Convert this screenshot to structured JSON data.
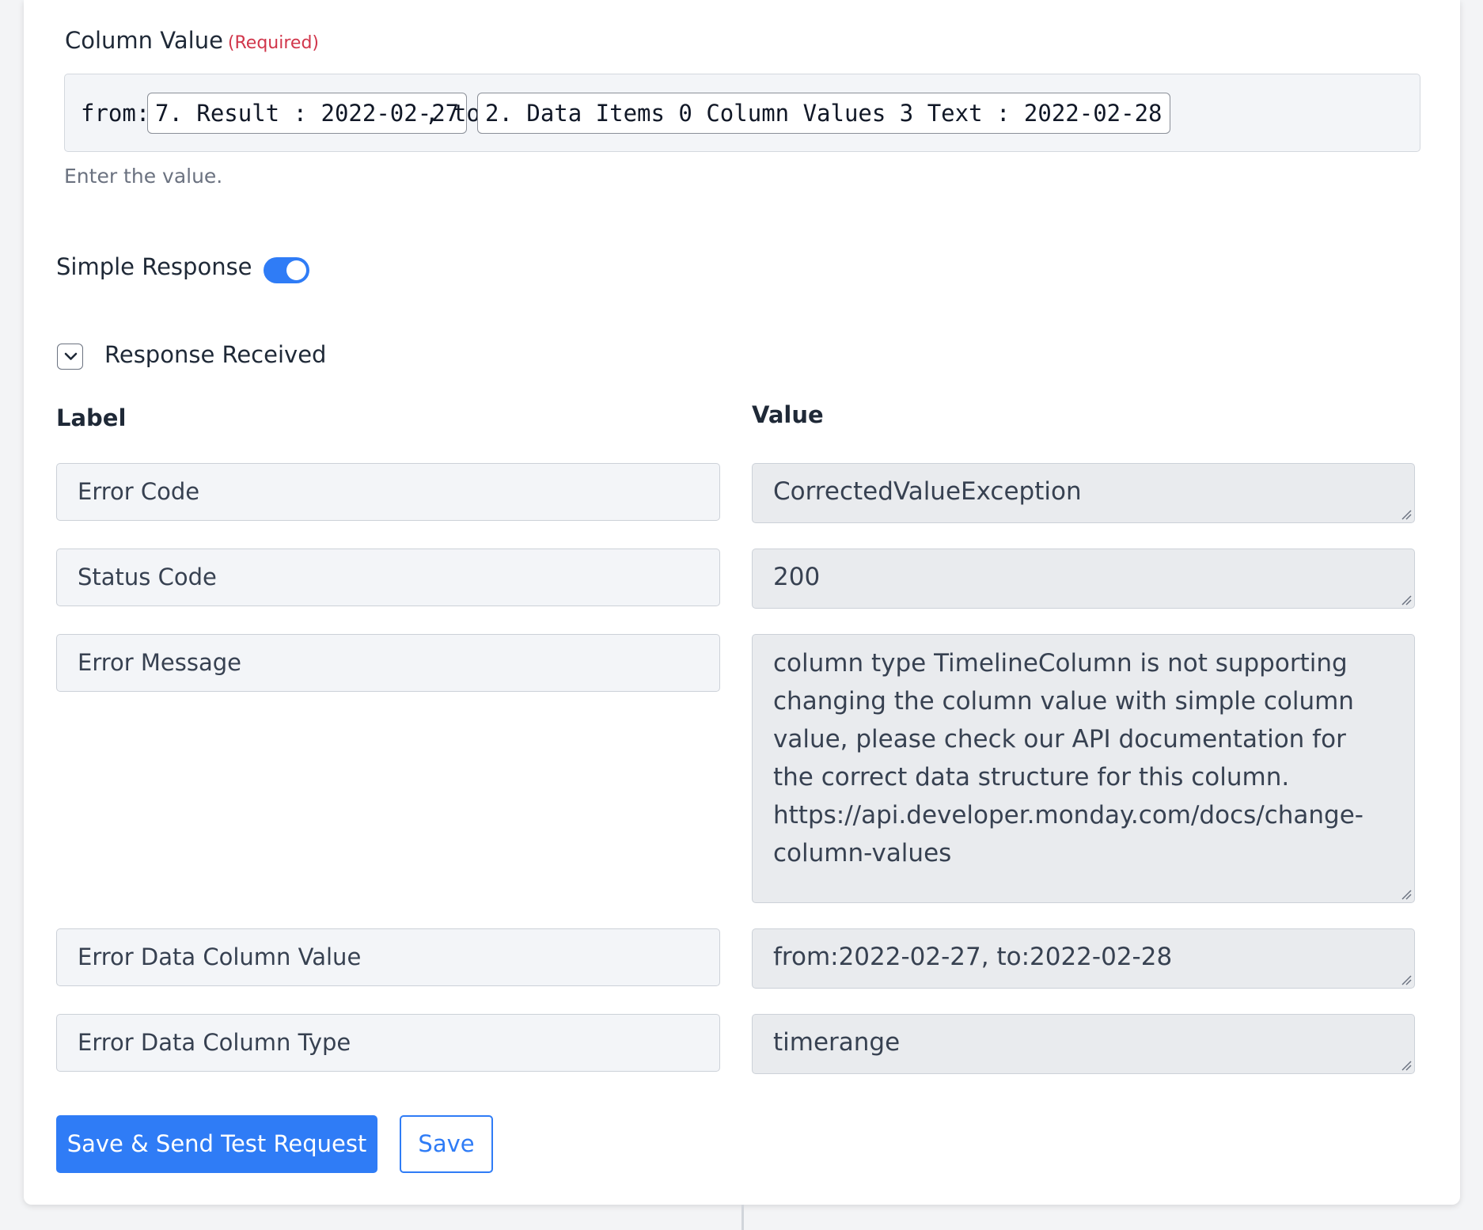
{
  "column_value": {
    "label": "Column Value",
    "required": "(Required)",
    "from_prefix": "from:",
    "token_1": "7. Result : 2022-02-27",
    "to_prefix": ", to:",
    "token_2": "2. Data Items 0 Column Values 3 Text : 2022-02-28",
    "help_text": "Enter the value."
  },
  "simple_response": {
    "label": "Simple Response",
    "enabled": true
  },
  "response_received": {
    "label": "Response Received",
    "expanded": true,
    "label_header": "Label",
    "value_header": "Value",
    "rows": [
      {
        "label": "Error Code",
        "value": "CorrectedValueException"
      },
      {
        "label": "Status Code",
        "value": "200"
      },
      {
        "label": "Error Message",
        "value": "column type TimelineColumn is not supporting changing the column value with simple column value, please check our API documentation for the correct data structure for this column. https://api.developer.monday.com/docs/change-column-values"
      },
      {
        "label": "Error Data Column Value",
        "value": "from:2022-02-27, to:2022-02-28"
      },
      {
        "label": "Error Data Column Type",
        "value": "timerange"
      }
    ]
  },
  "actions": {
    "primary_label": "Save & Send Test Request",
    "secondary_label": "Save"
  },
  "colors": {
    "accent": "#2f7cf6",
    "required": "#d1364b"
  }
}
